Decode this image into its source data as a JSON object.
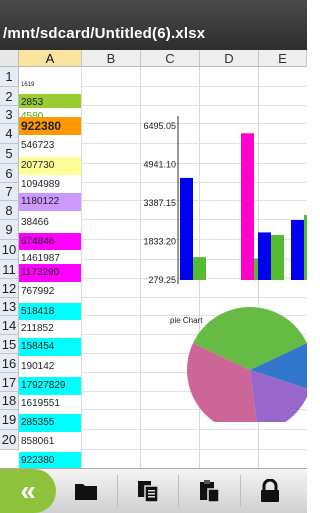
{
  "window": {
    "title": "/mnt/sdcard/Untitled(6).xlsx"
  },
  "columns": [
    "A",
    "B",
    "C",
    "D",
    "E"
  ],
  "rows": [
    "1",
    "2",
    "3",
    "4",
    "5",
    "6",
    "7",
    "8",
    "9",
    "10",
    "11",
    "12",
    "13",
    "14",
    "15",
    "16",
    "17",
    "18",
    "19",
    "20"
  ],
  "cells": [
    {
      "row": "1",
      "value": "1619",
      "bg": "#ffffff",
      "color": "#222222"
    },
    {
      "row": "2",
      "value": "2853",
      "bg": "#99cc33",
      "color": "#222222"
    },
    {
      "row": "3a",
      "value": "4580",
      "bg": "#ffffff",
      "color": "#55aa11"
    },
    {
      "row": "3b",
      "value": "922380",
      "bg": "#ff9900",
      "color": "#222222"
    },
    {
      "row": "4",
      "value": "546723",
      "bg": "#ffffff",
      "color": "#222222"
    },
    {
      "row": "5",
      "value": "207730",
      "bg": "#ffff99",
      "color": "#222222"
    },
    {
      "row": "6",
      "value": "1094989",
      "bg": "#ffffff",
      "color": "#222222"
    },
    {
      "row": "7",
      "value": "1180122",
      "bg": "#cc99ff",
      "color": "#222222"
    },
    {
      "row": "8",
      "value": "38466",
      "bg": "#ffffff",
      "color": "#222222"
    },
    {
      "row": "9",
      "value": "674846",
      "bg": "#ff00ff",
      "color": "#222222"
    },
    {
      "row": "10",
      "value": "1461987",
      "bg": "#ffffff",
      "color": "#222222"
    },
    {
      "row": "10b",
      "value": "1173290",
      "bg": "#ff00ff",
      "color": "#222222"
    },
    {
      "row": "11",
      "value": "767992",
      "bg": "#ffffff",
      "color": "#222222"
    },
    {
      "row": "12",
      "value": "518418",
      "bg": "#00ffff",
      "color": "#222222"
    },
    {
      "row": "13",
      "value": "211852",
      "bg": "#ffffff",
      "color": "#222222"
    },
    {
      "row": "14",
      "value": "158454",
      "bg": "#00ffff",
      "color": "#222222"
    },
    {
      "row": "15",
      "value": "190142",
      "bg": "#ffffff",
      "color": "#222222"
    },
    {
      "row": "16",
      "value": "17927829",
      "bg": "#00ffff",
      "color": "#222222"
    },
    {
      "row": "17",
      "value": "1619551",
      "bg": "#ffffff",
      "color": "#222222"
    },
    {
      "row": "18",
      "value": "285355",
      "bg": "#00ffff",
      "color": "#222222"
    },
    {
      "row": "19",
      "value": "858061",
      "bg": "#ffffff",
      "color": "#222222"
    },
    {
      "row": "20",
      "value": "922380",
      "bg": "#00ffff",
      "color": "#222222"
    }
  ],
  "chart_data": [
    {
      "type": "bar",
      "title": "",
      "yticks": [
        "6495.05",
        "4941.10",
        "3387.15",
        "1833.20",
        "279.25"
      ],
      "ylim": [
        279.25,
        6495.05
      ],
      "series": [
        {
          "color": "#0000ee",
          "values": [
            4400,
            null,
            2200,
            2700
          ]
        },
        {
          "color": "#ff00cc",
          "values": [
            null,
            6200,
            null,
            null
          ]
        },
        {
          "color": "#55bb33",
          "values": [
            1200,
            1150,
            2100,
            2900
          ]
        }
      ]
    },
    {
      "type": "pie",
      "title": "pie Chart",
      "slices": [
        {
          "color": "#66bb44",
          "value": 36
        },
        {
          "color": "#3377cc",
          "value": 12
        },
        {
          "color": "#9966cc",
          "value": 18
        },
        {
          "color": "#cc6699",
          "value": 34
        }
      ]
    }
  ],
  "toolbar": {
    "back_icon": "double-chevron-left-icon",
    "open_icon": "folder-icon",
    "copy_icon": "copy-document-icon",
    "paste_icon": "clipboard-icon",
    "lock_icon": "lock-icon",
    "accent": "#8fc23c"
  }
}
